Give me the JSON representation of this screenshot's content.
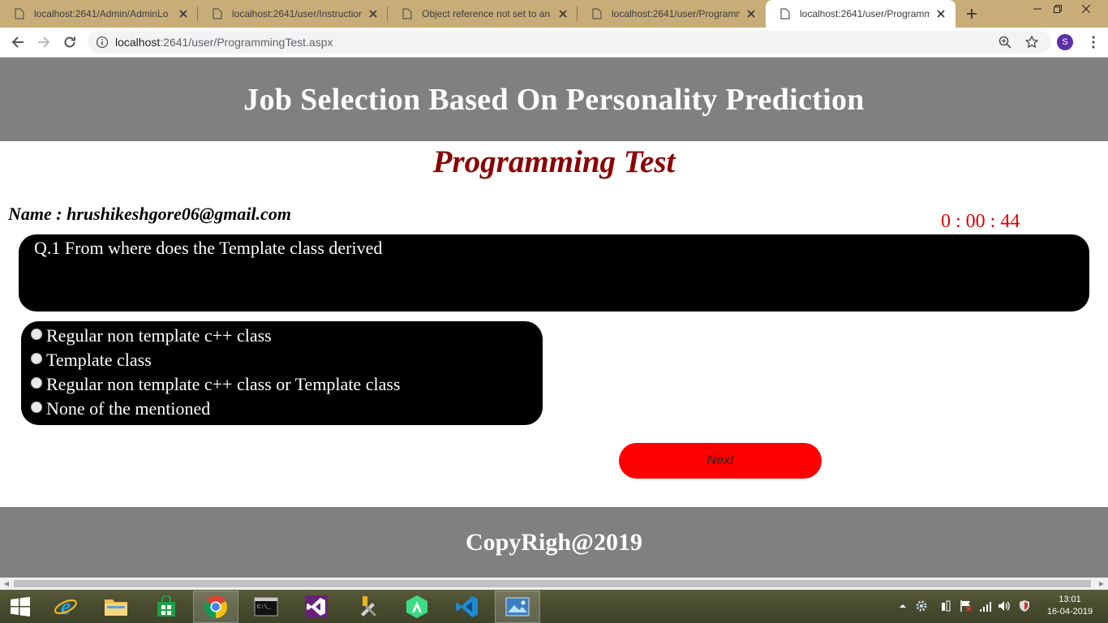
{
  "browser": {
    "tabs": [
      {
        "title": "localhost:2641/Admin/AdminLo",
        "active": false
      },
      {
        "title": "localhost:2641/user/InstructionP",
        "active": false
      },
      {
        "title": "Object reference not set to an in",
        "active": false
      },
      {
        "title": "localhost:2641/user/Programmi",
        "active": false
      },
      {
        "title": "localhost:2641/user/Programmi",
        "active": true
      }
    ],
    "url_host": "localhost",
    "url_rest": ":2641/user/ProgrammingTest.aspx",
    "profile_initial": "S"
  },
  "page": {
    "site_title": "Job Selection Based On Personality Prediction",
    "test_title": "Programming Test",
    "user_line": "Name : hrushikeshgore06@gmail.com",
    "timer": "0 : 00 : 44",
    "question": "Q.1 From where does the Template class derived",
    "options": [
      "Regular non template c++ class",
      "Template class",
      "Regular non template c++ class or Template class",
      "None of the mentioned"
    ],
    "next_label": "Next",
    "footer": "CopyRigh@2019"
  },
  "taskbar": {
    "time": "13:01",
    "date": "16-04-2019",
    "apps": [
      "windows-start",
      "internet-explorer",
      "file-explorer",
      "microsoft-store",
      "chrome",
      "command-prompt",
      "visual-studio",
      "tools",
      "android-studio",
      "vs-code",
      "photos"
    ]
  },
  "colors": {
    "tabstrip": "#c9ad78",
    "header_gray": "#808080",
    "test_title": "#8b0000",
    "timer": "#e00000",
    "next_button": "#ff0000"
  }
}
